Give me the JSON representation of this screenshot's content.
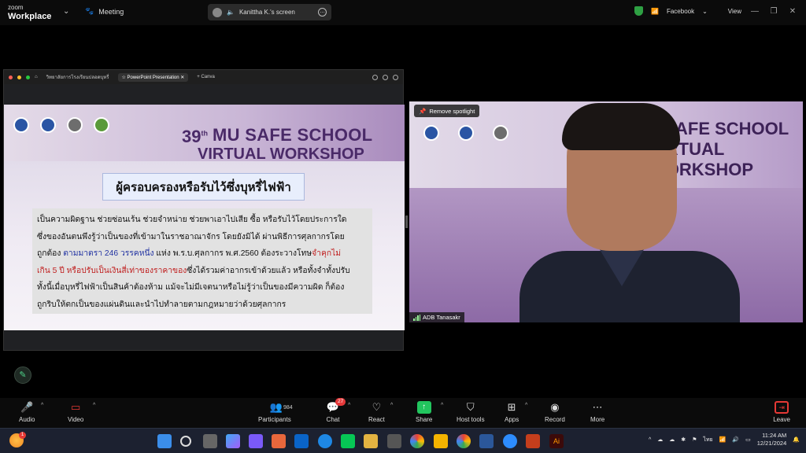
{
  "app": {
    "logo_small": "zoom",
    "logo_big": "Workplace",
    "meeting_label": "Meeting",
    "screen_share_label": "Kanittha K.'s screen",
    "facebook_label": "Facebook",
    "view_label": "View"
  },
  "browser": {
    "tab1": "วิทยาลัยการโรงเรียนปลอดบุหรี่",
    "tab2": "PowerPoint Presentation",
    "tab3": "Canva"
  },
  "slide": {
    "number": "39",
    "number_sup": "th",
    "title_line1": "MU SAFE SCHOOL",
    "title_line2": "VIRTUAL WORKSHOP",
    "box_heading": "ผู้ครอบครองหรือรับไว้ซึ่งบุหรี่ไฟฟ้า",
    "p1": "เป็นความผิดฐาน ช่วยซ่อนเร้น ช่วยจำหน่าย ช่วยพาเอาไปเสีย ซื้อ หรือรับไว้โดยประการใด",
    "p2": "ซึ่งของอันตนพึงรู้ว่าเป็นของที่เข้ามาในราชอาณาจักร โดยยังมิได้ ผ่านพิธีการศุลกากรโดย",
    "p3a": "ถูกต้อง ",
    "p3b": "ตามมาตรา 246   วรรคหนึ่ง",
    "p3c": " แห่ง พ.ร.บ.ศุลกากร พ.ศ.2560 ต้องระวางโทษ",
    "p3d": "จำคุกไม่",
    "p4a": "เกิน 5 ปี หรือปรับเป็นเงินสี่เท่าของราคาของ",
    "p4b": "ซึ่งได้รวมค่าอากรเข้าด้วยแล้ว หรือทั้งจำทั้งปรับ",
    "p5": "ทั้งนี้เมื่อบุหรี่ไฟฟ้าเป็นสินค้าต้องห้าม แม้จะไม่มีเจตนาหรือไม่รู้ว่าเป็นของมีความผิด ก็ต้อง",
    "p6": "ถูกริบให้ตกเป็นของแผ่นดินและนำไปทำลายตามกฎหมายว่าด้วยศุลกากร"
  },
  "video": {
    "title_line1": "MU SAFE SCHOOL",
    "title_line2": "VIRTUAL WORKSHOP",
    "spotlight_btn": "Remove spotlight",
    "participant_name": "ADB Tanasakr"
  },
  "toolbar": {
    "audio": "Audio",
    "video": "Video",
    "participants": "Participants",
    "participants_count": "984",
    "chat": "Chat",
    "chat_badge": "27",
    "react": "React",
    "share": "Share",
    "host_tools": "Host tools",
    "apps": "Apps",
    "record": "Record",
    "more": "More",
    "leave": "Leave"
  },
  "taskbar": {
    "weather_badge": "1",
    "lang": "ไทย",
    "time": "11:24 AM",
    "date": "12/21/2024"
  }
}
